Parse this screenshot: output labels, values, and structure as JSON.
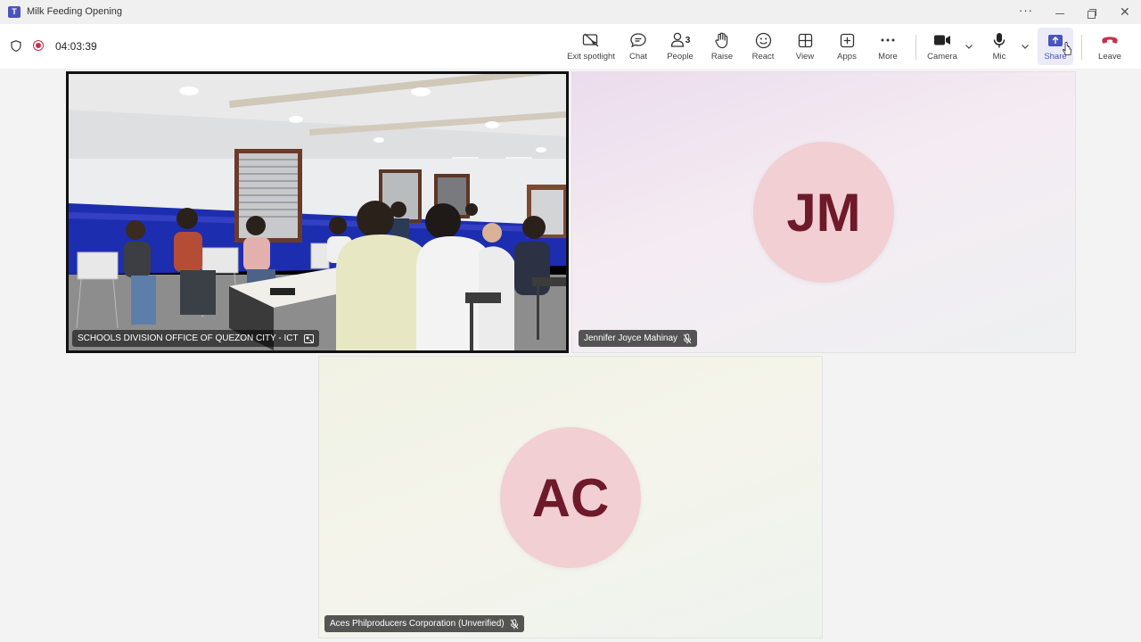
{
  "window": {
    "title": "Milk Feeding Opening",
    "app_logo_letter": "T",
    "more_glyph": "···",
    "close_glyph": "✕"
  },
  "meeting": {
    "timer": "04:03:39",
    "recording": true
  },
  "toolbar": {
    "buttons": [
      {
        "id": "exit-spotlight",
        "label": "Exit spotlight",
        "icon": "exit-spotlight-icon"
      },
      {
        "id": "chat",
        "label": "Chat",
        "icon": "chat-icon"
      },
      {
        "id": "people",
        "label": "People",
        "icon": "people-icon",
        "count": "3"
      },
      {
        "id": "raise",
        "label": "Raise",
        "icon": "raise-hand-icon"
      },
      {
        "id": "react",
        "label": "React",
        "icon": "react-icon"
      },
      {
        "id": "view",
        "label": "View",
        "icon": "view-grid-icon"
      },
      {
        "id": "apps",
        "label": "Apps",
        "icon": "apps-icon"
      },
      {
        "id": "more",
        "label": "More",
        "icon": "more-icon"
      },
      {
        "id": "camera",
        "label": "Camera",
        "icon": "camera-icon"
      },
      {
        "id": "mic",
        "label": "Mic",
        "icon": "mic-icon"
      },
      {
        "id": "share",
        "label": "Share",
        "icon": "share-icon"
      },
      {
        "id": "leave",
        "label": "Leave",
        "icon": "leave-phone-icon"
      }
    ]
  },
  "participants": [
    {
      "name": "SCHOOLS DIVISION OFFICE OF QUEZON CITY - ICT",
      "initials": "",
      "video": true,
      "spotlight": true
    },
    {
      "name": "Jennifer Joyce Mahinay",
      "initials": "JM",
      "muted": true
    },
    {
      "name": "Aces Philproducers Corporation (Unverified)",
      "initials": "AC",
      "muted": true
    }
  ],
  "colors": {
    "accent": "#4b53bc",
    "leave": "#c4314b",
    "avatar_bg": "#f1cfd3",
    "avatar_text": "#6e1a2b"
  }
}
